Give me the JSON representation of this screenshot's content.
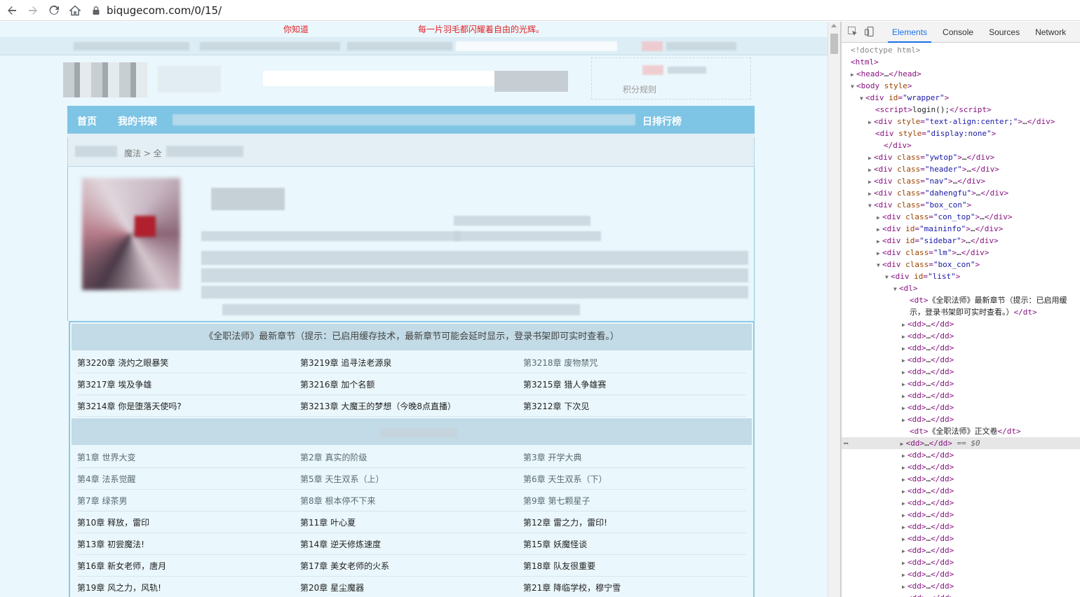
{
  "browser": {
    "url": "biqugecom.com/0/15/"
  },
  "page": {
    "notice": "你知道　　　　　　　　　　　　　每一片羽毛都闪耀着自由的光辉。",
    "user_note": "积分规则",
    "nav": [
      "首页",
      "我的书架",
      "日排行榜"
    ],
    "crumb": "魔法 > 全"
  },
  "latest": {
    "header": "《全职法师》最新章节（提示：已启用缓存技术，最新章节可能会延时显示，登录书架即可实时查看。）",
    "rows": [
      [
        "第3220章 浇灼之眼暴笑",
        "第3219章 追寻法老源泉",
        "第3218章 废物禁咒"
      ],
      [
        "第3217章 埃及争雄",
        "第3216章 加个名额",
        "第3215章 猎人争雄赛"
      ],
      [
        "第3214章 你是堕落天使吗?",
        "第3213章 大魔王的梦想（今晚8点直播）",
        "第3212章 下次见"
      ]
    ]
  },
  "main": {
    "rows": [
      [
        "第1章 世界大变",
        "第2章 真实的阶级",
        "第3章 开学大典"
      ],
      [
        "第4章 法系觉醒",
        "第5章 天生双系（上）",
        "第6章 天生双系（下）"
      ],
      [
        "第7章 绿茶男",
        "第8章 根本停不下来",
        "第9章 第七颗星子"
      ],
      [
        "第10章 释放，雷印",
        "第11章 叶心夏",
        "第12章 雷之力，雷印!"
      ],
      [
        "第13章 初尝魔法!",
        "第14章 逆天修炼速度",
        "第15章 妖魔怪谈"
      ],
      [
        "第16章 新女老师，唐月",
        "第17章 美女老师的火系",
        "第18章 队友很重要"
      ],
      [
        "第19章 风之力，风轨!",
        "第20章 星尘魔器",
        "第21章 降临学校，穆宁雪"
      ]
    ]
  },
  "devtools": {
    "tabs": [
      "Elements",
      "Console",
      "Sources",
      "Network"
    ],
    "dt_latest": "《全职法师》最新章节（提示：已启用缓",
    "dt_latest2": "示，登录书架即可实时查看。）",
    "dt_main": "《全职法师》正文卷",
    "selected_suffix": "== $0"
  }
}
